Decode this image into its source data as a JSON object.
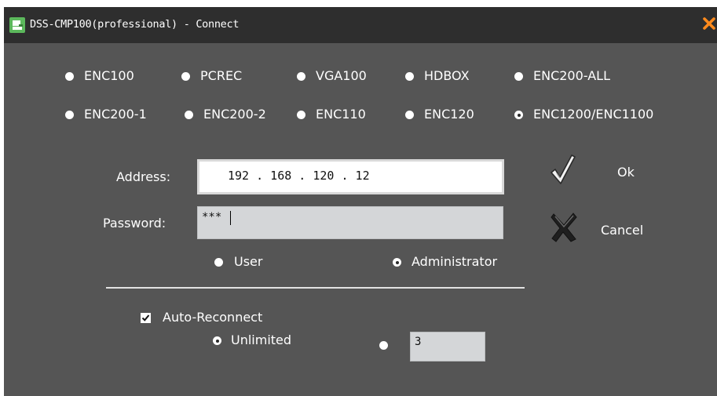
{
  "window": {
    "title": "DSS-CMP100(professional) - Connect",
    "icons": {
      "app": "app-icon",
      "close": "close-icon"
    },
    "colors": {
      "background": "#555555",
      "titlebar": "#2e2e2e",
      "close": "#ff8a1c"
    }
  },
  "device_types": {
    "options": [
      "ENC100",
      "PCREC",
      "VGA100",
      "HDBOX",
      "ENC200-ALL",
      "ENC200-1",
      "ENC200-2",
      "ENC110",
      "ENC120",
      "ENC1200/ENC1100"
    ],
    "selected": "ENC1200/ENC1100"
  },
  "address": {
    "label": "Address:",
    "value": "192 . 168 . 120 . 12"
  },
  "password": {
    "label": "Password:",
    "value": "***"
  },
  "role": {
    "options": [
      "User",
      "Administrator"
    ],
    "selected": "Administrator"
  },
  "reconnect": {
    "label": "Auto-Reconnect",
    "checked": true,
    "options": [
      "Unlimited"
    ],
    "selected": "Unlimited",
    "count_value": "3"
  },
  "actions": {
    "ok_label": "Ok",
    "cancel_label": "Cancel",
    "ok_icon": "checkmark-icon",
    "cancel_icon": "cross-icon"
  }
}
